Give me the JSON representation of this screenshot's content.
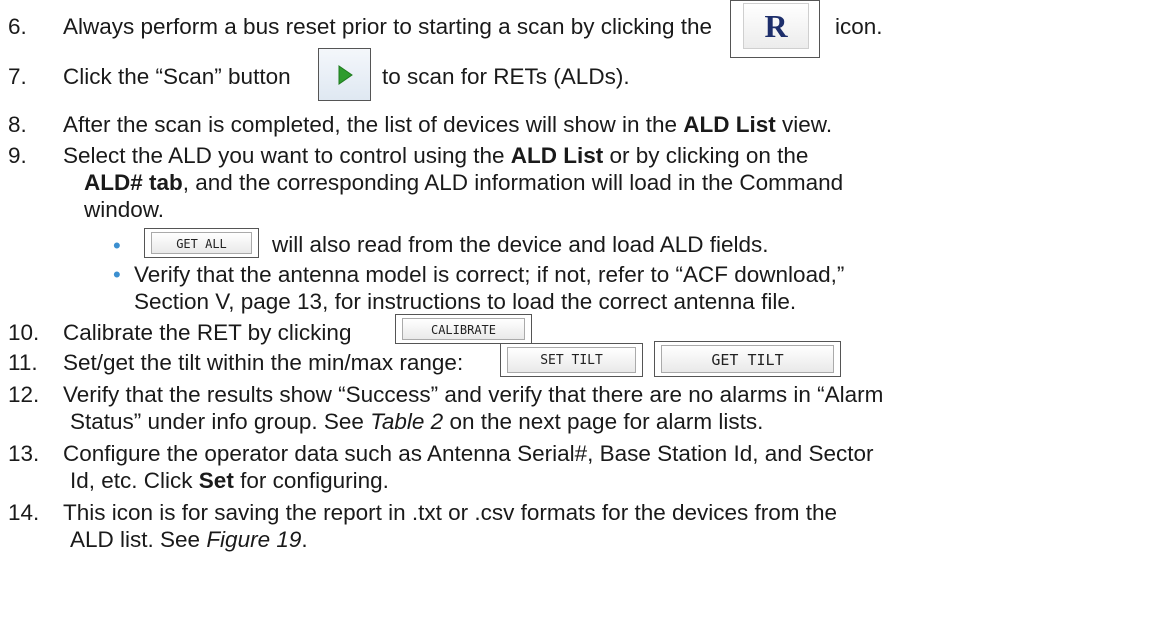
{
  "steps": [
    {
      "num": "6.",
      "before": "Always perform a bus reset prior to starting a scan by clicking the",
      "after": "icon."
    },
    {
      "num": "7.",
      "before": "Click the “Scan” button",
      "after": "to scan for RETs (ALDs)."
    },
    {
      "num": "8.",
      "before": "After the scan is completed, the list of devices will show in the ",
      "bold": "ALD List",
      "after": " view."
    },
    {
      "num": "9.",
      "l1a": "Select the ALD you want to control using the ",
      "l1b": "ALD List",
      "l1c": " or by clicking on the",
      "l2b": "ALD# tab",
      "l2c": ", and the corresponding ALD information will load in the Command",
      "l3": "window."
    },
    {
      "num": "10.",
      "before": "Calibrate the RET by clicking"
    },
    {
      "num": "11.",
      "before": "Set/get the tilt within the min/max range:"
    },
    {
      "num": "12.",
      "l1": "Verify that the results show “Success” and verify that there are no alarms in “Alarm",
      "l2a": "Status” under info group. See ",
      "l2i": "Table 2",
      "l2c": " on the next page for alarm lists."
    },
    {
      "num": "13.",
      "l1": "Configure the operator data such as Antenna Serial#, Base Station Id, and Sector",
      "l2a": "Id, etc. Click ",
      "l2b": "Set",
      "l2c": " for configuring."
    },
    {
      "num": "14.",
      "l1": "This icon is for saving the report in .txt or .csv formats for the devices from the",
      "l2a": "ALD list. See ",
      "l2i": "Figure 19",
      "l2c": "."
    }
  ],
  "bullets": {
    "b1_after": "will also read from the device and load ALD fields.",
    "b2_l1": "Verify that the antenna model is correct; if not, refer to “ACF download,”",
    "b2_l2": "Section V, page 13, for instructions to load the correct antenna file."
  },
  "buttons": {
    "reset_icon": "R",
    "get_all": "GET ALL",
    "calibrate": "CALIBRATE",
    "set_tilt": "SET TILT",
    "get_tilt": "GET TILT"
  },
  "colors": {
    "bullet": "#3b8fd0",
    "text": "#1a1a1a",
    "reset_icon": "#1d2e6b",
    "play_icon": "#2e9c2e"
  },
  "icons": {
    "reset": "bus-reset-icon",
    "scan": "play-icon"
  }
}
